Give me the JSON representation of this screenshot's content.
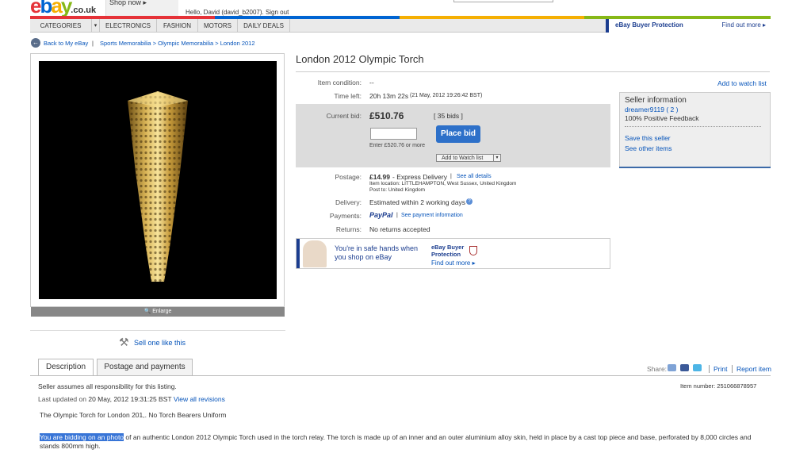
{
  "header": {
    "logo_tld": ".co.uk",
    "shop_now": "Shop now ▸",
    "greeting": "Hello, David (david_b2007). Sign out",
    "colors": {
      "red": "#e53238",
      "blue": "#0064d2",
      "yellow": "#f5af02",
      "green": "#86b817"
    }
  },
  "nav": {
    "items": [
      "CATEGORIES",
      "ELECTRONICS",
      "FASHION",
      "MOTORS",
      "DAILY DEALS"
    ],
    "protection": "eBay Buyer Protection",
    "find_out_more": "Find out more ▸"
  },
  "breadcrumb": {
    "back": "Back to My eBay",
    "sep": "|",
    "path": "Sports Memorabilia > Olympic Memorabilia > London 2012"
  },
  "gallery": {
    "enlarge": "🔍 Enlarge",
    "sell_one": "Sell one like this"
  },
  "item": {
    "title": "London 2012 Olympic Torch",
    "condition_label": "Item condition:",
    "condition_value": "--",
    "time_left_label": "Time left:",
    "time_left": "20h 13m 22s",
    "end_time": "(21 May, 2012 19:26:42 BST)",
    "current_bid_label": "Current bid:",
    "current_bid": "£510.76",
    "bids": "[ 35 bids ]",
    "place_bid": "Place bid",
    "enter_hint": "Enter £520.76 or more",
    "add_watch": "Add to Watch list",
    "postage_label": "Postage:",
    "postage_price": "£14.99",
    "postage_service": "- Express Delivery",
    "see_details": "See all details",
    "location": "Item location: LITTLEHAMPTON, West Sussex, United Kingdom",
    "post_to": "Post to: United Kingdom",
    "delivery_label": "Delivery:",
    "delivery": "Estimated within 2 working days",
    "payments_label": "Payments:",
    "paypal": "PayPal",
    "payment_info": "See payment information",
    "returns_label": "Returns:",
    "returns": "No returns accepted"
  },
  "protection_banner": {
    "message": "You're in safe hands when you shop on eBay",
    "title": "eBay Buyer Protection",
    "find_out": "Find out more ▸"
  },
  "seller": {
    "add_watch": "Add to watch list",
    "heading": "Seller information",
    "name": "dreamer9119",
    "feedback": "( 2 )",
    "positive": "100% Positive Feedback",
    "save": "Save this seller",
    "other_items": "See other items"
  },
  "tabs": {
    "description": "Description",
    "postage": "Postage and payments"
  },
  "tools": {
    "share": "Share:",
    "print": "Print",
    "report": "Report item",
    "sep": "|"
  },
  "description": {
    "responsibility": "Seller assumes all responsibility for this listing.",
    "updated_prefix": "Last updated on",
    "updated_date": "20 May, 2012 19:31:25 BST",
    "view_revisions": "View all revisions",
    "item_number": "Item number: 251066878957",
    "summary": "The Olympic Torch for London 201,. No Torch Bearers Uniform",
    "highlighted": "You are bidding on an photo",
    "body": " of an authentic London 2012 Olympic Torch used in the torch relay. The torch is made up of an inner and an outer aluminium alloy skin, held in place by a cast top piece and base, perforated by 8,000 circles and stands 800mm high."
  }
}
